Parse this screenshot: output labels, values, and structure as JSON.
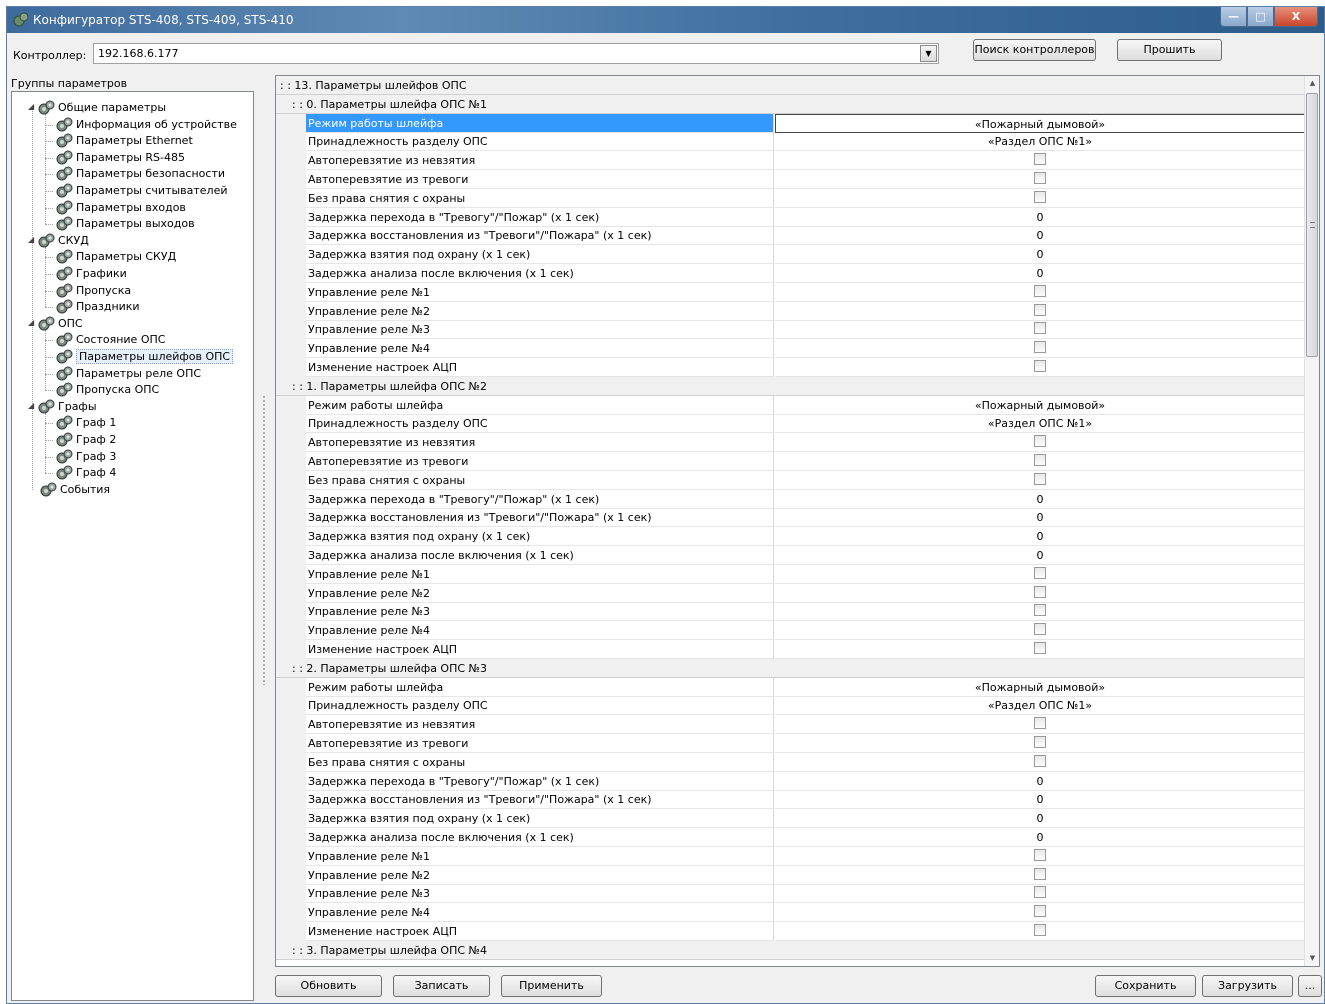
{
  "window": {
    "title": "Конфигуратор STS-408, STS-409, STS-410",
    "min_glyph": "—",
    "max_glyph": "□",
    "close_glyph": "X"
  },
  "toolbar": {
    "controller_label": "Контроллер:",
    "controller_value": "192.168.6.177",
    "search_label": "Поиск контроллеров",
    "flash_label": "Прошить"
  },
  "tree": {
    "title": "Группы параметров",
    "nodes": [
      {
        "label": "Общие параметры"
      },
      {
        "label": "Информация об устройстве"
      },
      {
        "label": "Параметры Ethernet"
      },
      {
        "label": "Параметры RS-485"
      },
      {
        "label": "Параметры безопасности"
      },
      {
        "label": "Параметры считывателей"
      },
      {
        "label": "Параметры входов"
      },
      {
        "label": "Параметры выходов"
      },
      {
        "label": "СКУД"
      },
      {
        "label": "Параметры СКУД"
      },
      {
        "label": "Графики"
      },
      {
        "label": "Пропуска"
      },
      {
        "label": "Праздники"
      },
      {
        "label": "ОПС"
      },
      {
        "label": "Состояние ОПС"
      },
      {
        "label": "Параметры шлейфов ОПС"
      },
      {
        "label": "Параметры реле ОПС"
      },
      {
        "label": "Пропуска ОПС"
      },
      {
        "label": "Графы"
      },
      {
        "label": "Граф 1"
      },
      {
        "label": "Граф 2"
      },
      {
        "label": "Граф 3"
      },
      {
        "label": "Граф 4"
      },
      {
        "label": "События"
      }
    ]
  },
  "grid": {
    "header": ": : 13. Параметры шлейфов ОПС",
    "groups": [
      {
        "title": ": : 0. Параметры шлейфа ОПС №1",
        "rows": [
          {
            "name": "Режим работы шлейфа",
            "value": "«Пожарный дымовой»"
          },
          {
            "name": "Принадлежность разделу ОПС",
            "value": "«Раздел ОПС №1»"
          },
          {
            "name": "Автоперевзятие из невзятия",
            "checkbox": true
          },
          {
            "name": "Автоперевзятие из тревоги",
            "checkbox": true
          },
          {
            "name": "Без права снятия с охраны",
            "checkbox": true
          },
          {
            "name": "Задержка перехода в \"Тревогу\"/\"Пожар\" (x 1 сек)",
            "value": "0"
          },
          {
            "name": "Задержка восстановления из \"Тревоги\"/\"Пожара\" (x 1 сек)",
            "value": "0"
          },
          {
            "name": "Задержка взятия под охрану (x 1 сек)",
            "value": "0"
          },
          {
            "name": "Задержка анализа после включения (x 1 сек)",
            "value": "0"
          },
          {
            "name": "Управление реле №1",
            "checkbox": true
          },
          {
            "name": "Управление реле №2",
            "checkbox": true
          },
          {
            "name": "Управление реле №3",
            "checkbox": true
          },
          {
            "name": "Управление реле №4",
            "checkbox": true
          },
          {
            "name": "Изменение настроек АЦП",
            "checkbox": true
          }
        ]
      },
      {
        "title": ": : 1. Параметры шлейфа ОПС №2",
        "rows": [
          {
            "name": "Режим работы шлейфа",
            "value": "«Пожарный дымовой»"
          },
          {
            "name": "Принадлежность разделу ОПС",
            "value": "«Раздел ОПС №1»"
          },
          {
            "name": "Автоперевзятие из невзятия",
            "checkbox": true
          },
          {
            "name": "Автоперевзятие из тревоги",
            "checkbox": true
          },
          {
            "name": "Без права снятия с охраны",
            "checkbox": true
          },
          {
            "name": "Задержка перехода в \"Тревогу\"/\"Пожар\" (x 1 сек)",
            "value": "0"
          },
          {
            "name": "Задержка восстановления из \"Тревоги\"/\"Пожара\" (x 1 сек)",
            "value": "0"
          },
          {
            "name": "Задержка взятия под охрану (x 1 сек)",
            "value": "0"
          },
          {
            "name": "Задержка анализа после включения (x 1 сек)",
            "value": "0"
          },
          {
            "name": "Управление реле №1",
            "checkbox": true
          },
          {
            "name": "Управление реле №2",
            "checkbox": true
          },
          {
            "name": "Управление реле №3",
            "checkbox": true
          },
          {
            "name": "Управление реле №4",
            "checkbox": true
          },
          {
            "name": "Изменение настроек АЦП",
            "checkbox": true
          }
        ]
      },
      {
        "title": ": : 2. Параметры шлейфа ОПС №3",
        "rows": [
          {
            "name": "Режим работы шлейфа",
            "value": "«Пожарный дымовой»"
          },
          {
            "name": "Принадлежность разделу ОПС",
            "value": "«Раздел ОПС №1»"
          },
          {
            "name": "Автоперевзятие из невзятия",
            "checkbox": true
          },
          {
            "name": "Автоперевзятие из тревоги",
            "checkbox": true
          },
          {
            "name": "Без права снятия с охраны",
            "checkbox": true
          },
          {
            "name": "Задержка перехода в \"Тревогу\"/\"Пожар\" (x 1 сек)",
            "value": "0"
          },
          {
            "name": "Задержка восстановления из \"Тревоги\"/\"Пожара\" (x 1 сек)",
            "value": "0"
          },
          {
            "name": "Задержка взятия под охрану (x 1 сек)",
            "value": "0"
          },
          {
            "name": "Задержка анализа после включения (x 1 сек)",
            "value": "0"
          },
          {
            "name": "Управление реле №1",
            "checkbox": true
          },
          {
            "name": "Управление реле №2",
            "checkbox": true
          },
          {
            "name": "Управление реле №3",
            "checkbox": true
          },
          {
            "name": "Управление реле №4",
            "checkbox": true
          },
          {
            "name": "Изменение настроек АЦП",
            "checkbox": true
          }
        ]
      },
      {
        "title": ": : 3. Параметры шлейфа ОПС №4",
        "rows": []
      }
    ]
  },
  "bottom": {
    "refresh_label": "Обновить",
    "write_label": "Записать",
    "apply_label": "Применить",
    "save_label": "Сохранить",
    "load_label": "Загрузить",
    "more_label": "..."
  },
  "colors": {
    "selection": "#3399ff",
    "category_bg": "#f0f0f0"
  }
}
